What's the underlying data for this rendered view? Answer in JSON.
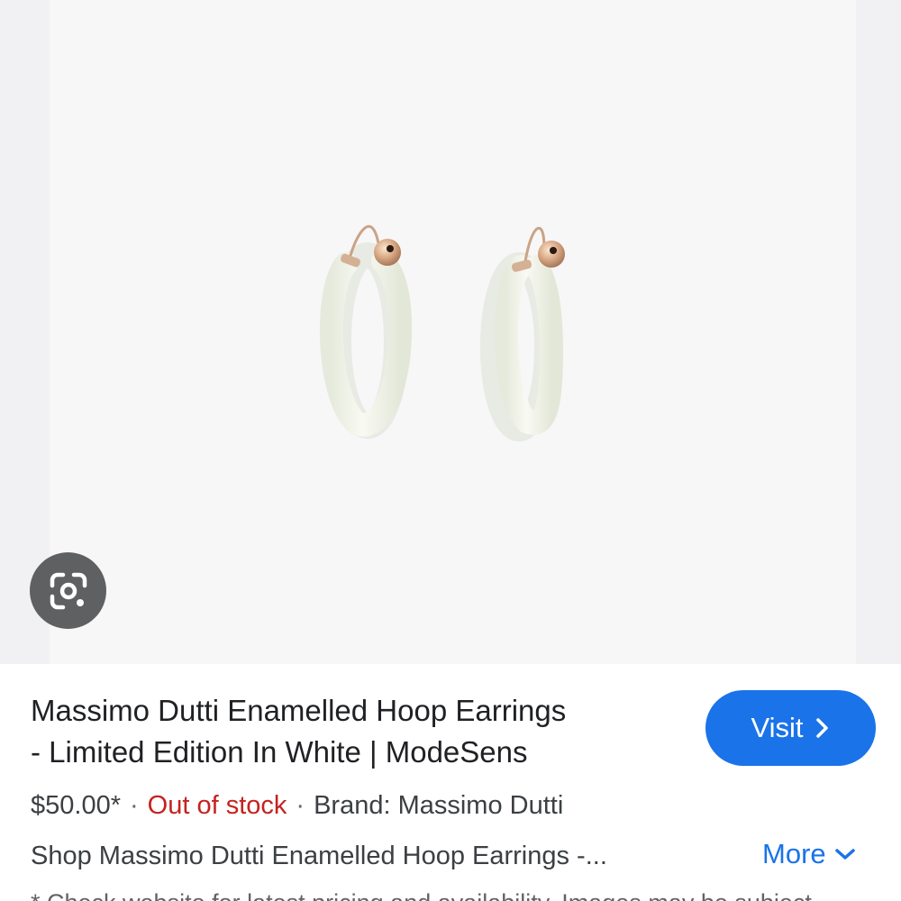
{
  "product": {
    "title_line1": "Massimo Dutti Enamelled Hoop Earrings",
    "title_line2": "- Limited Edition In White | ModeSens",
    "price": "$50.00*",
    "separator": "·",
    "stock_status": "Out of stock",
    "brand": "Brand: Massimo Dutti",
    "description": "Shop Massimo Dutti Enamelled Hoop Earrings -...",
    "footnote": "* Check website for latest pricing and availability. Images may be subject"
  },
  "actions": {
    "visit_label": "Visit",
    "more_label": "More"
  },
  "icons": {
    "lens": "google-lens-icon",
    "visit_arrow": "chevron-right-icon",
    "more_arrow": "chevron-down-icon"
  },
  "colors": {
    "accent": "#1a73e8",
    "out_of_stock": "#c5221f",
    "lens_button": "#5f6062"
  }
}
